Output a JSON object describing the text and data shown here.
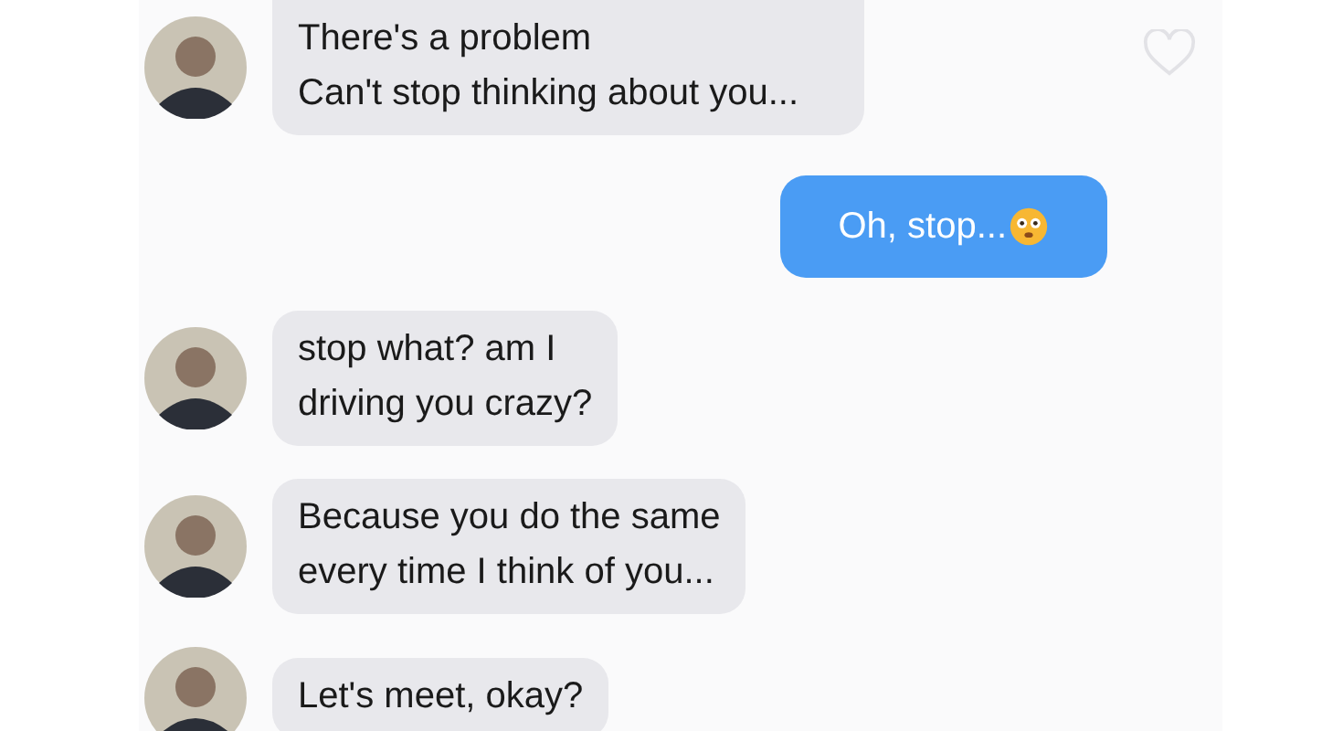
{
  "messages": [
    {
      "kind": "incoming",
      "lines": [
        "There's a problem",
        "Can't stop thinking about you..."
      ],
      "liked": false
    },
    {
      "kind": "outgoing",
      "lines": [
        "Oh, stop..."
      ],
      "emoji": true
    },
    {
      "kind": "incoming",
      "lines": [
        "stop what? am I",
        "driving you crazy?"
      ]
    },
    {
      "kind": "incoming",
      "lines": [
        "Because you do the same",
        "every time I think of you..."
      ]
    },
    {
      "kind": "incoming",
      "lines": [
        "Let's meet, okay?"
      ]
    }
  ]
}
